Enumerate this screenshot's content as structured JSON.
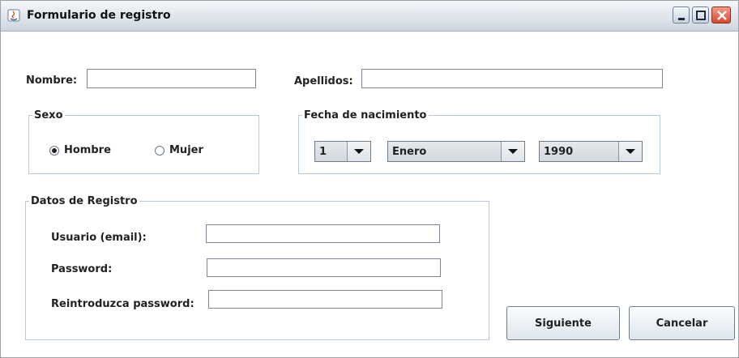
{
  "window": {
    "title": "Formulario de registro",
    "icons": [
      "java-app-icon",
      "minimize-icon",
      "maximize-icon",
      "close-icon"
    ]
  },
  "form": {
    "nombre_label": "Nombre:",
    "nombre_value": "",
    "apellidos_label": "Apellidos:",
    "apellidos_value": ""
  },
  "sexo": {
    "legend": "Sexo",
    "options": [
      {
        "label": "Hombre",
        "selected": true
      },
      {
        "label": "Mujer",
        "selected": false
      }
    ]
  },
  "fecha": {
    "legend": "Fecha de nacimiento",
    "day": "1",
    "month": "Enero",
    "year": "1990"
  },
  "registro": {
    "legend": "Datos de Registro",
    "usuario_label": "Usuario (email):",
    "password_label": "Password:",
    "repassword_label": "Reintroduzca password:",
    "usuario_value": "",
    "password_value": "",
    "repassword_value": ""
  },
  "buttons": {
    "next": "Siguiente",
    "cancel": "Cancelar"
  }
}
